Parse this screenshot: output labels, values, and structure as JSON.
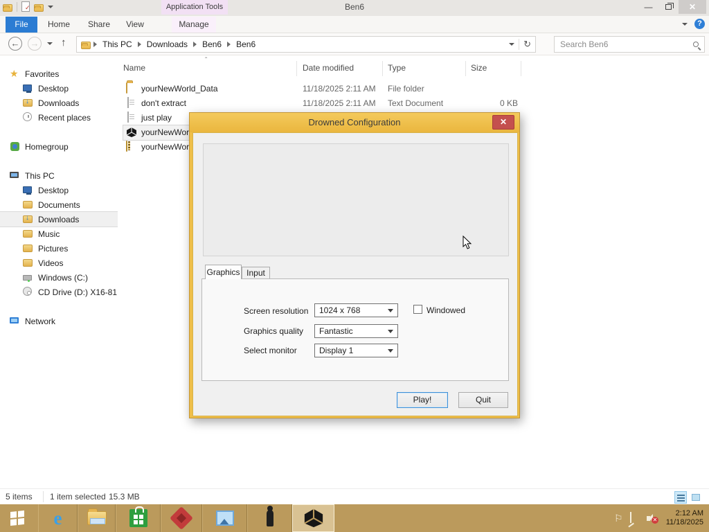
{
  "window": {
    "title": "Ben6",
    "contextual_tab": "Application Tools"
  },
  "ribbon": {
    "tabs": [
      "File",
      "Home",
      "Share",
      "View",
      "Manage"
    ]
  },
  "address": {
    "crumbs": [
      "This PC",
      "Downloads",
      "Ben6",
      "Ben6"
    ],
    "search_placeholder": "Search Ben6"
  },
  "sidebar": {
    "items": [
      {
        "label": "Favorites"
      },
      {
        "label": "Desktop"
      },
      {
        "label": "Downloads"
      },
      {
        "label": "Recent places"
      },
      {
        "label": "Homegroup"
      },
      {
        "label": "This PC"
      },
      {
        "label": "Desktop"
      },
      {
        "label": "Documents"
      },
      {
        "label": "Downloads"
      },
      {
        "label": "Music"
      },
      {
        "label": "Pictures"
      },
      {
        "label": "Videos"
      },
      {
        "label": "Windows (C:)"
      },
      {
        "label": "CD Drive (D:) X16-81"
      },
      {
        "label": "Network"
      }
    ]
  },
  "filelist": {
    "columns": [
      "Name",
      "Date modified",
      "Type",
      "Size"
    ],
    "rows": [
      {
        "name": "yourNewWorld_Data",
        "date": "11/18/2025 2:11 AM",
        "type": "File folder",
        "size": ""
      },
      {
        "name": "don't extract",
        "date": "11/18/2025 2:11 AM",
        "type": "Text Document",
        "size": "0 KB"
      },
      {
        "name": "just play",
        "date": "",
        "type": "",
        "size": ""
      },
      {
        "name": "yourNewWorl",
        "date": "",
        "type": "",
        "size": ""
      },
      {
        "name": "yourNewWorl",
        "date": "",
        "type": "",
        "size": ""
      }
    ]
  },
  "statusbar": {
    "count": "5 items",
    "selected": "1 item selected",
    "size": "15.3 MB"
  },
  "dialog": {
    "title": "Drowned Configuration",
    "close_label": "x",
    "tabs": [
      "Graphics",
      "Input"
    ],
    "fields": [
      {
        "label": "Screen resolution",
        "value": "1024 x 768"
      },
      {
        "label": "Graphics quality",
        "value": "Fantastic"
      },
      {
        "label": "Select monitor",
        "value": "Display 1"
      }
    ],
    "windowed_label": "Windowed",
    "play_label": "Play!",
    "quit_label": "Quit"
  },
  "tray": {
    "time": "2:12 AM",
    "date": "11/18/2025"
  },
  "colors": {
    "dialog_gold": "#efbf4a",
    "dialog_close_red": "#c4504e",
    "file_tab_blue": "#2b7cd3",
    "contextual_tab": "#f2e0f4",
    "taskbar_tan": "#bb9a5c"
  }
}
